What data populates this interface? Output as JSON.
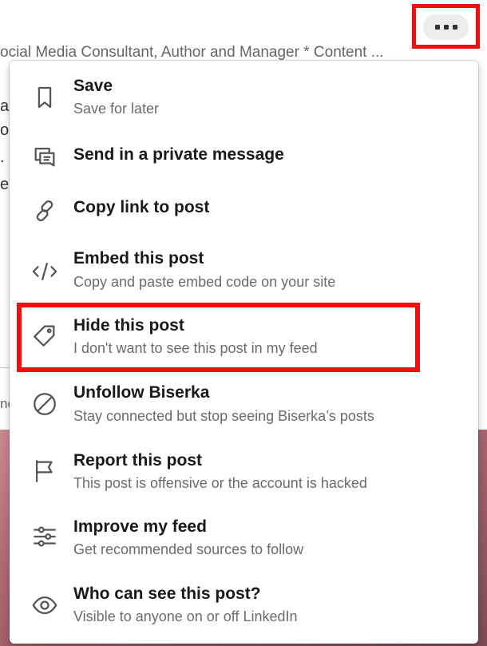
{
  "background": {
    "subtitle": "ocial Media Consultant, Author and Manager * Content ...",
    "fragments": [
      "a",
      "o",
      ".",
      "er",
      "ne"
    ]
  },
  "more_button": {
    "icon": "more-horizontal-icon"
  },
  "menu": {
    "items": [
      {
        "icon": "bookmark-icon",
        "title": "Save",
        "desc": "Save for later"
      },
      {
        "icon": "message-icon",
        "title": "Send in a private message",
        "desc": ""
      },
      {
        "icon": "link-icon",
        "title": "Copy link to post",
        "desc": ""
      },
      {
        "icon": "code-icon",
        "title": "Embed this post",
        "desc": "Copy and paste embed code on your site"
      },
      {
        "icon": "tag-icon",
        "title": "Hide this post",
        "desc": "I don't want to see this post in my feed"
      },
      {
        "icon": "block-icon",
        "title": "Unfollow Biserka",
        "desc": "Stay connected but stop seeing Biserka’s posts"
      },
      {
        "icon": "flag-icon",
        "title": "Report this post",
        "desc": "This post is offensive or the account is hacked"
      },
      {
        "icon": "sliders-icon",
        "title": "Improve my feed",
        "desc": "Get recommended sources to follow"
      },
      {
        "icon": "eye-icon",
        "title": "Who can see this post?",
        "desc": "Visible to anyone on or off LinkedIn"
      }
    ]
  },
  "colors": {
    "highlight": "#ee1111",
    "title": "#191919",
    "desc": "#6b6b6b"
  }
}
